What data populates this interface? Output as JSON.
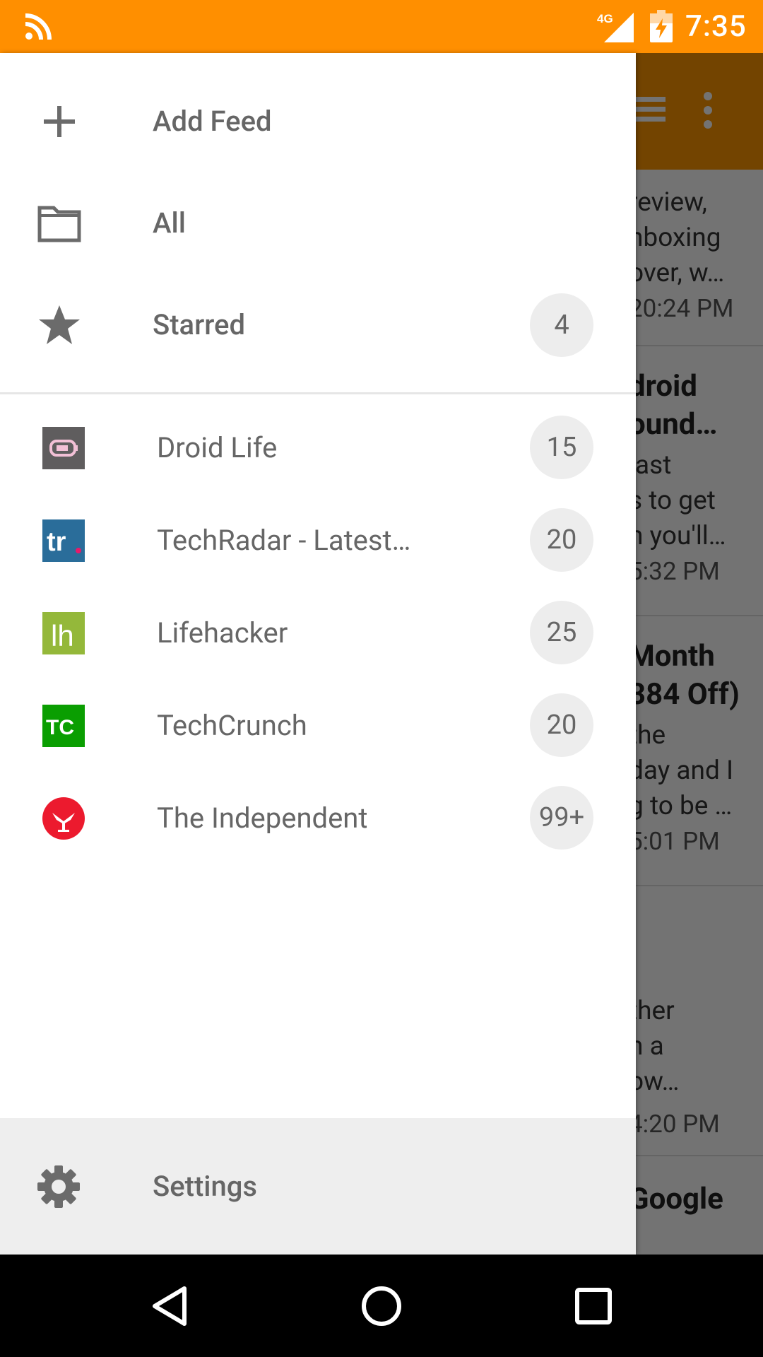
{
  "status_bar": {
    "left_icon": "rss-icon",
    "network": "4G",
    "time": "7:35",
    "color": "#ff8f00"
  },
  "background": {
    "toolbar_color": "#ff9800",
    "fragments": [
      {
        "text": "review,",
        "style": "normal"
      },
      {
        "text": "nboxing",
        "style": "normal"
      },
      {
        "text": "over, w…",
        "style": "normal"
      },
      {
        "text": "20:24 PM",
        "style": "time"
      },
      {
        "text": "droid",
        "style": "bold"
      },
      {
        "text": "ound…",
        "style": "bold"
      },
      {
        "text": "last",
        "style": "normal"
      },
      {
        "text": "s to get",
        "style": "normal"
      },
      {
        "text": "n you'll…",
        "style": "normal"
      },
      {
        "text": "5:32 PM",
        "style": "time"
      },
      {
        "text": "Month",
        "style": "bold"
      },
      {
        "text": "384 Off)",
        "style": "bold"
      },
      {
        "text": "the",
        "style": "normal"
      },
      {
        "text": "day and I",
        "style": "normal"
      },
      {
        "text": "g to be …",
        "style": "normal"
      },
      {
        "text": "5:01 PM",
        "style": "time"
      },
      {
        "text": "ther",
        "style": "normal"
      },
      {
        "text": "n a",
        "style": "normal"
      },
      {
        "text": "ow…",
        "style": "normal"
      },
      {
        "text": "4:20 PM",
        "style": "time"
      },
      {
        "text": "Google",
        "style": "bold"
      }
    ]
  },
  "drawer": {
    "menu": [
      {
        "label": "Add Feed",
        "icon": "plus-icon"
      },
      {
        "label": "All",
        "icon": "folder-icon"
      },
      {
        "label": "Starred",
        "icon": "star-icon",
        "badge": "4"
      }
    ],
    "feeds": [
      {
        "label": "Droid Life",
        "badge": "15",
        "logo": "droid-life-logo"
      },
      {
        "label": "TechRadar - Latest…",
        "badge": "20",
        "logo": "techradar-logo",
        "logo_text": "tr"
      },
      {
        "label": "Lifehacker",
        "badge": "25",
        "logo": "lifehacker-logo",
        "logo_text": "lh"
      },
      {
        "label": "TechCrunch",
        "badge": "20",
        "logo": "techcrunch-logo",
        "logo_text": "TC"
      },
      {
        "label": "The Independent",
        "badge": "99+",
        "logo": "independent-logo"
      }
    ],
    "settings": {
      "label": "Settings",
      "icon": "gear-icon"
    }
  },
  "nav_bar": {
    "buttons": [
      "back-icon",
      "home-icon",
      "recents-icon"
    ]
  }
}
